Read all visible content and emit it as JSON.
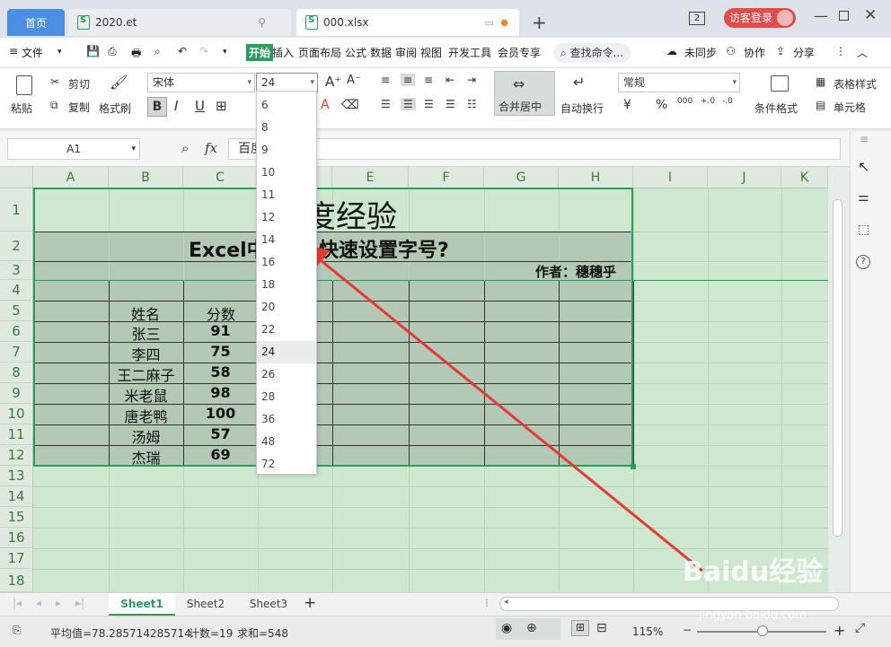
{
  "tabs": {
    "home": "首页",
    "file1": "2020.et",
    "file2": "000.xlsx",
    "badge": "2",
    "login": "访客登录"
  },
  "menu": {
    "file": "文件",
    "start": "开始",
    "insert": "插入",
    "layout": "页面布局",
    "formula": "公式",
    "data": "数据",
    "review": "审阅",
    "view": "视图",
    "dev": "开发工具",
    "vip": "会员专享",
    "search": "查找命令...",
    "sync": "未同步",
    "collab": "协作",
    "share": "分享"
  },
  "ribbon": {
    "paste": "粘贴",
    "cut": "剪切",
    "copy": "复制",
    "format_painter": "格式刷",
    "font_name": "宋体",
    "font_size": "24",
    "bold": "B",
    "italic": "I",
    "underline": "U",
    "merge_center": "合并居中",
    "auto_wrap": "自动换行",
    "number_format": "常规",
    "currency": "¥",
    "percent": "%",
    "thousands": "000",
    "cond_format": "条件格式",
    "table_style": "表格样式",
    "cell_style": "单元格"
  },
  "formula_bar": {
    "cell_ref": "A1",
    "fx": "fx",
    "content": "百度经验"
  },
  "columns": [
    "A",
    "B",
    "C",
    "D",
    "E",
    "F",
    "G",
    "H",
    "I",
    "J",
    "K"
  ],
  "rows": [
    "1",
    "2",
    "3",
    "4",
    "5",
    "6",
    "7",
    "8",
    "9",
    "10",
    "11",
    "12",
    "13",
    "14",
    "15",
    "16",
    "17",
    "18"
  ],
  "sheet": {
    "title": "度经验",
    "subtitle_left": "Excel中",
    "subtitle_right": "快速设置字号?",
    "author": "作者：穗穗乎",
    "header_name": "姓名",
    "header_score": "分数",
    "names": [
      "张三",
      "李四",
      "王二麻子",
      "米老鼠",
      "唐老鸭",
      "汤姆",
      "杰瑞"
    ],
    "scores": [
      "91",
      "75",
      "58",
      "98",
      "100",
      "57",
      "69"
    ]
  },
  "font_size_options": [
    "6",
    "8",
    "9",
    "10",
    "11",
    "12",
    "14",
    "16",
    "18",
    "20",
    "22",
    "24",
    "26",
    "28",
    "36",
    "48",
    "72"
  ],
  "font_size_selected": "24",
  "sheet_tabs": [
    "Sheet1",
    "Sheet2",
    "Sheet3"
  ],
  "status": {
    "average": "平均值=78.285714285714",
    "count": "计数=19",
    "sum": "求和=548",
    "zoom": "115%"
  },
  "watermark": {
    "logo": "Baidu经验",
    "url": "jingyan.baidu.com"
  },
  "colors": {
    "accent_green": "#2a9d5c",
    "selection_green": "#cde8cf",
    "home_tab_blue": "#4a8fe0",
    "arrow_red": "#e53935"
  }
}
